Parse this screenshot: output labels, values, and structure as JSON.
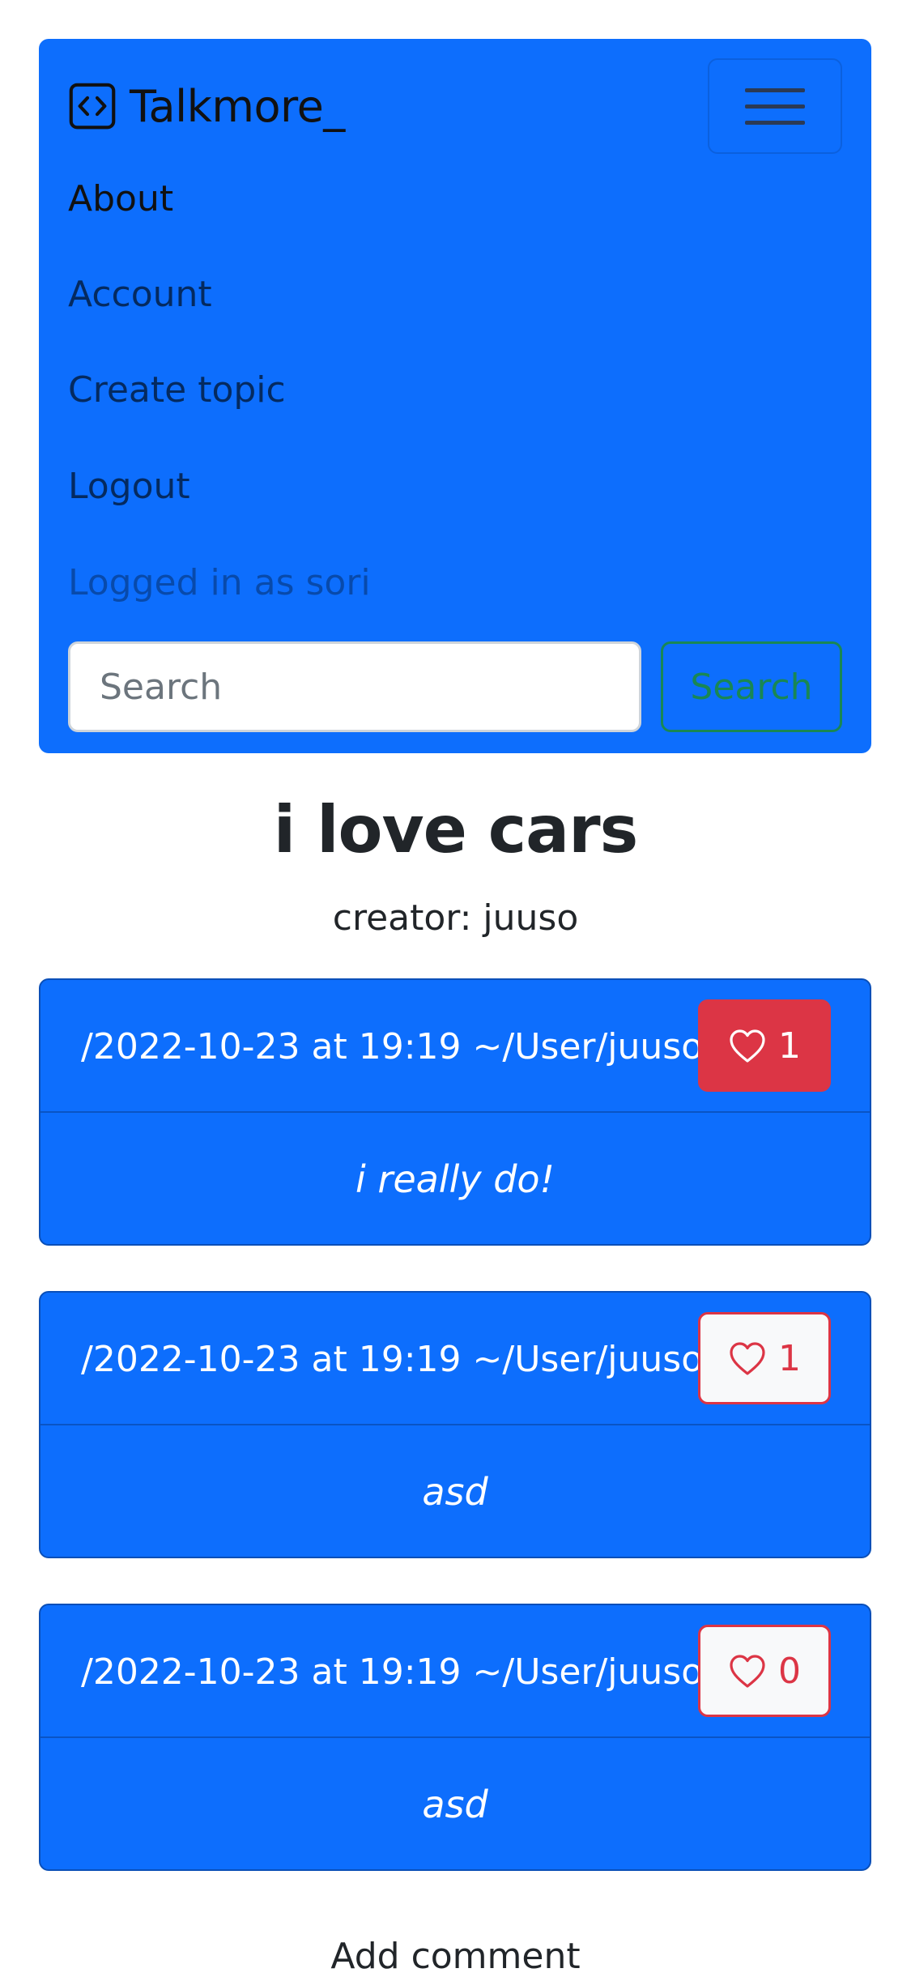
{
  "navbar": {
    "brand": "Talkmore_",
    "links": [
      "About",
      "Account",
      "Create topic",
      "Logout"
    ],
    "status": "Logged in as sori",
    "search_placeholder": "Search",
    "search_button": "Search"
  },
  "topic": {
    "title": "i love cars",
    "creator": "creator: juuso"
  },
  "comments": [
    {
      "meta": "/2022-10-23 at 19:19 ~/User/juuso",
      "likes": "1",
      "liked": true,
      "text": "i really do!"
    },
    {
      "meta": "/2022-10-23 at 19:19 ~/User/juuso",
      "likes": "1",
      "liked": false,
      "text": "asd"
    },
    {
      "meta": "/2022-10-23 at 19:19 ~/User/juuso",
      "likes": "0",
      "liked": false,
      "text": "asd"
    }
  ],
  "add_comment": "Add comment",
  "colors": {
    "primary": "#0d6efd",
    "danger": "#dc3545",
    "success": "#198754"
  },
  "icons": {
    "brand": "code-square-icon",
    "menu": "hamburger-menu-icon",
    "like": "heart-icon"
  }
}
